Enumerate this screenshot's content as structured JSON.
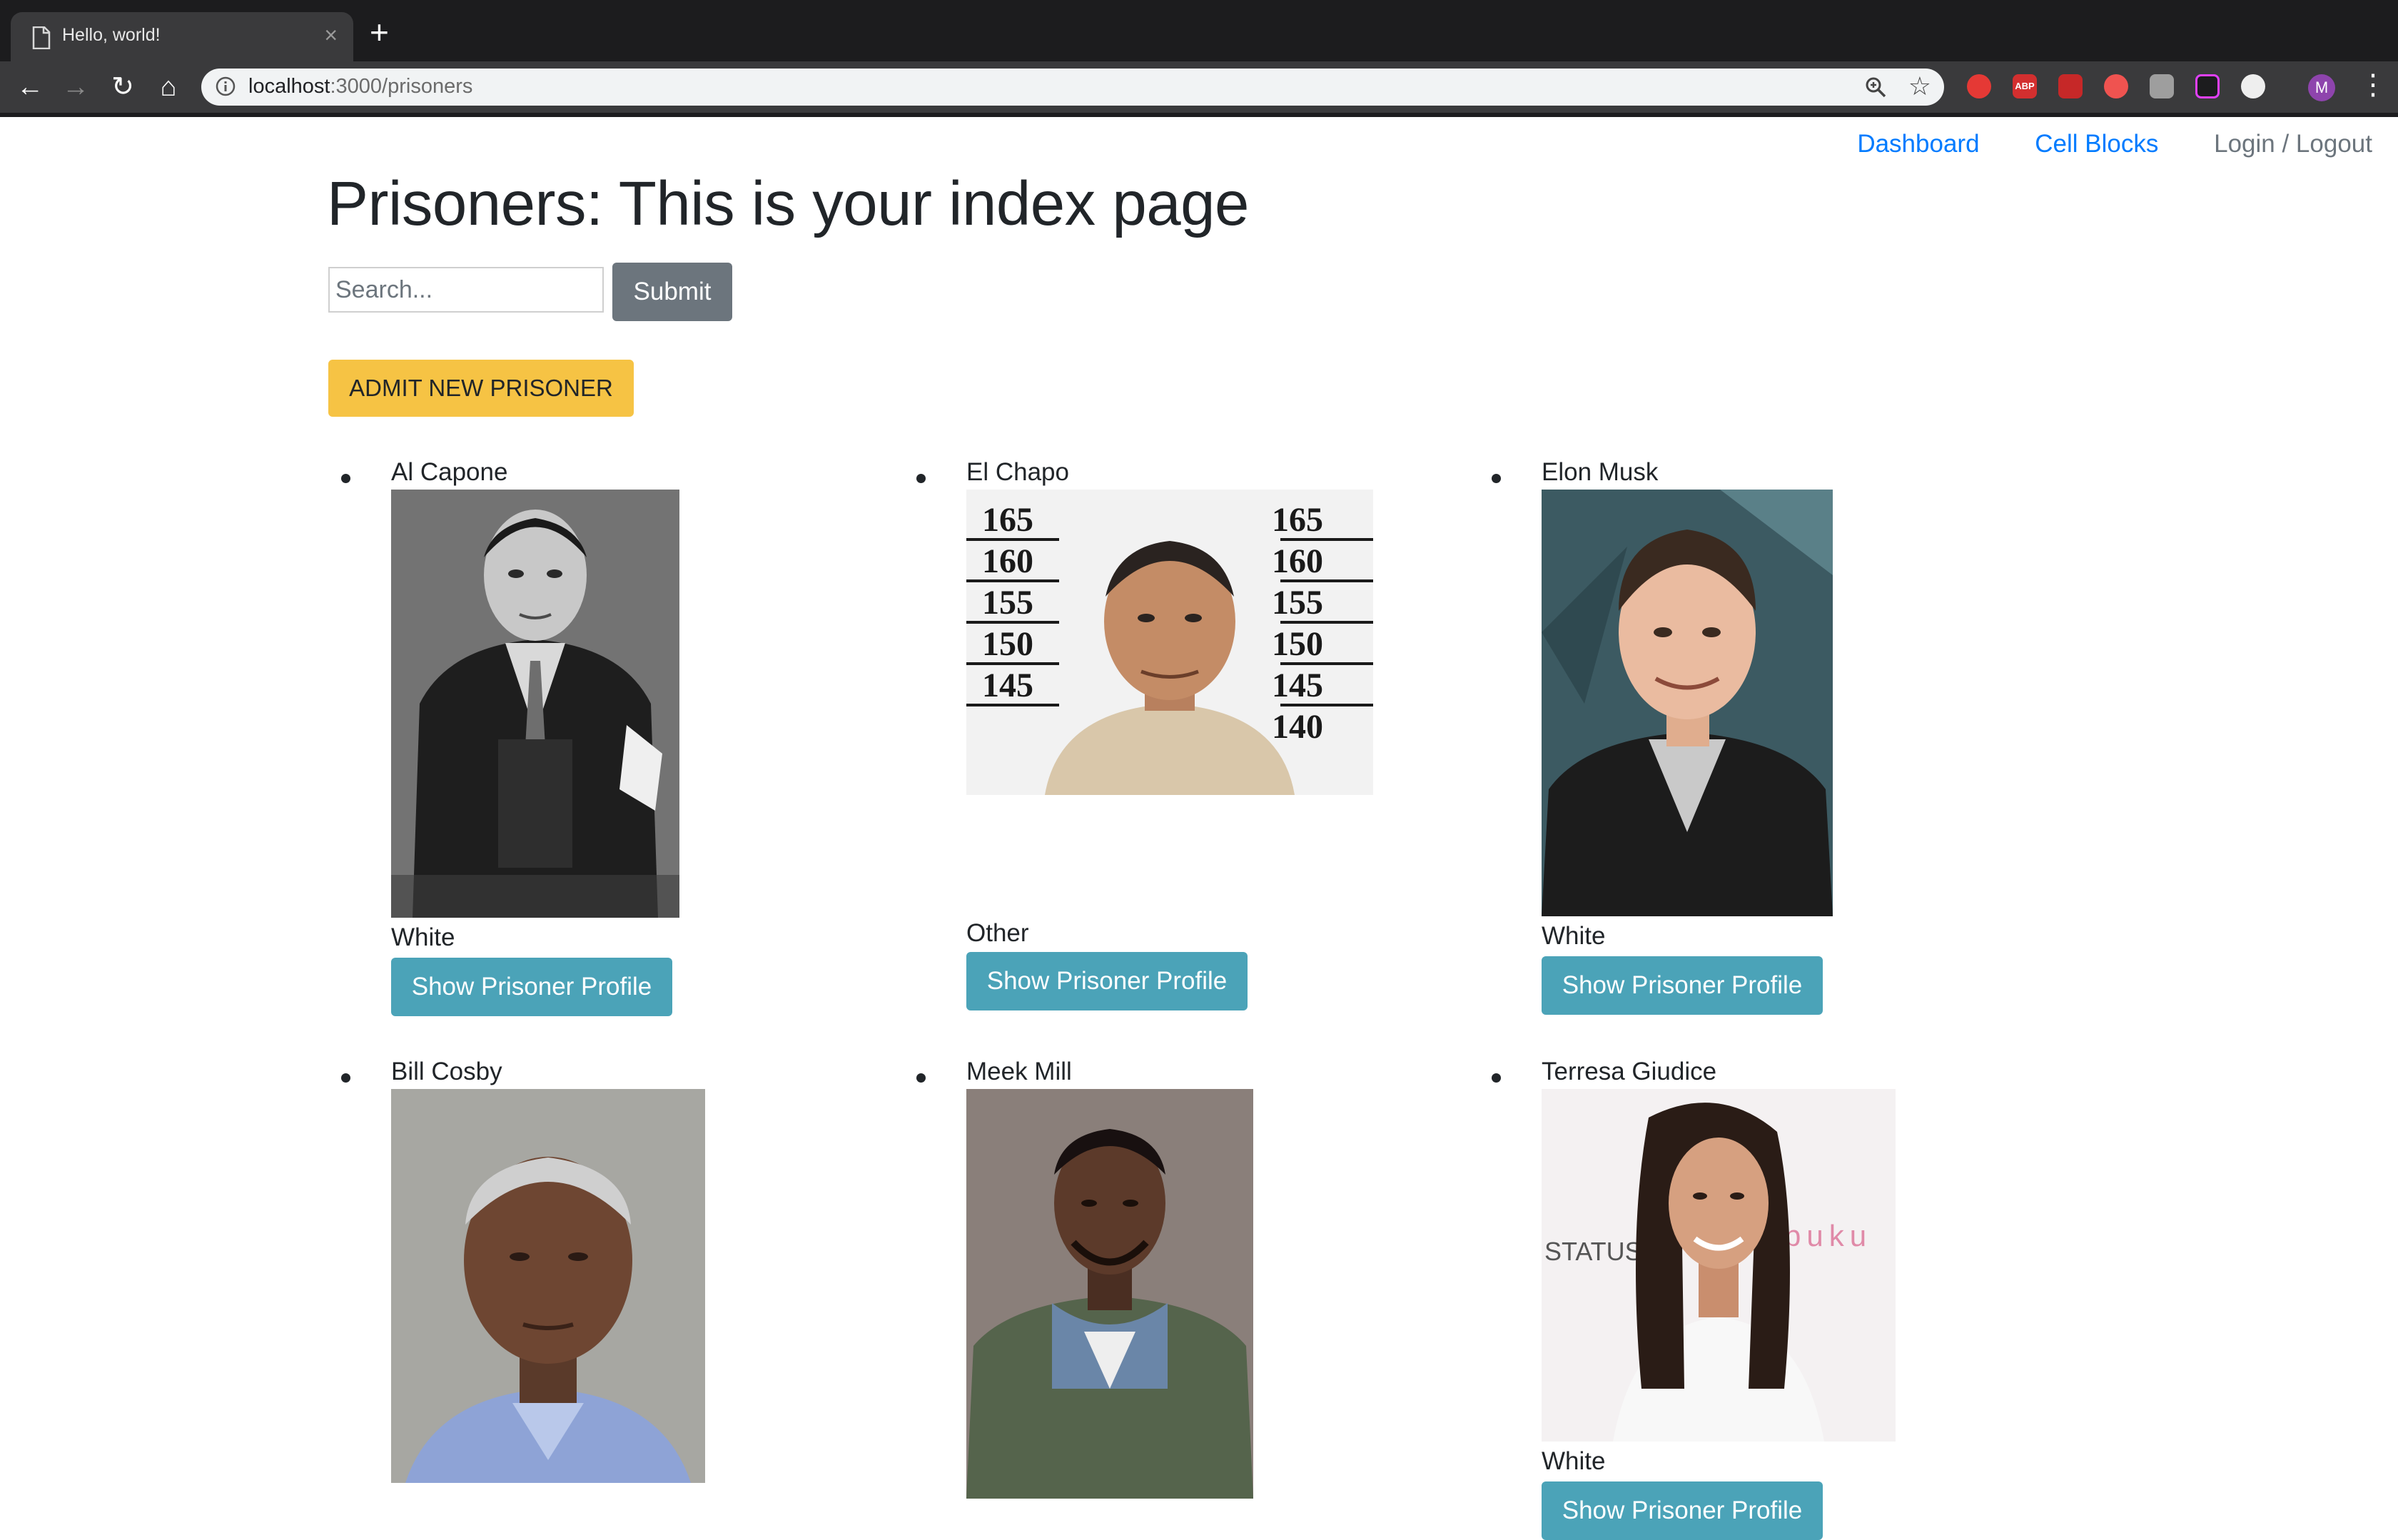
{
  "browser": {
    "tab_title": "Hello, world!",
    "url_host": "localhost",
    "url_path": ":3000/prisoners",
    "profile_initial": "M"
  },
  "nav": {
    "dashboard": "Dashboard",
    "cell_blocks": "Cell Blocks",
    "login_logout": "Login / Logout"
  },
  "page_title": "Prisoners: This is your index page",
  "search": {
    "placeholder": "Search...",
    "submit_label": "Submit"
  },
  "admit_label": "ADMIT NEW PRISONER",
  "prisoners": [
    {
      "name": "Al Capone",
      "race": "White",
      "button": "Show Prisoner Profile"
    },
    {
      "name": "El Chapo",
      "race": "Other",
      "button": "Show Prisoner Profile"
    },
    {
      "name": "Elon Musk",
      "race": "White",
      "button": "Show Prisoner Profile"
    },
    {
      "name": "Bill Cosby",
      "race": "",
      "button": ""
    },
    {
      "name": "Meek Mill",
      "race": "",
      "button": ""
    },
    {
      "name": "Terresa Giudice",
      "race": "White",
      "button": "Show Prisoner Profile"
    }
  ],
  "photo_texts": {
    "height_chart_1": "165",
    "height_chart_2": "160",
    "height_chart_3": "155",
    "height_chart_4": "150",
    "height_chart_5": "145",
    "height_chart_6": "140",
    "backdrop_left": "STATUS",
    "backdrop_right": "puku"
  },
  "colors": {
    "link": "#007bff",
    "submit": "#6c757d",
    "admit": "#f6c344",
    "show_button": "#4ba3b8"
  }
}
